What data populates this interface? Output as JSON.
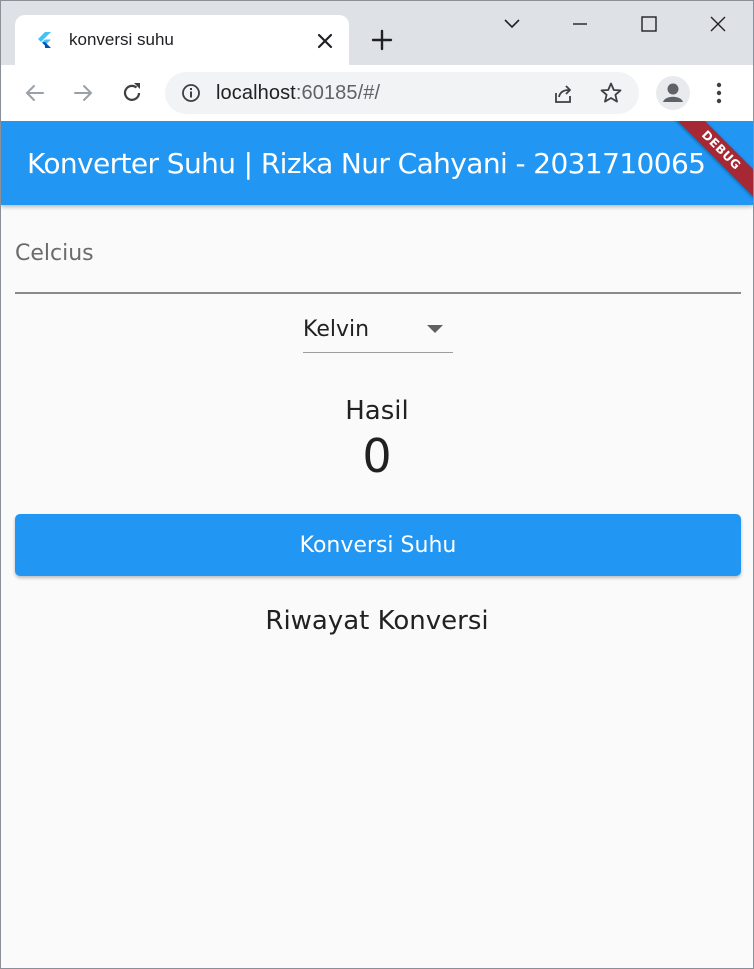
{
  "browser": {
    "tab": {
      "title": "konversi suhu",
      "favicon": "flutter-logo-icon"
    },
    "address": {
      "host": "localhost",
      "rest": ":60185/#/"
    },
    "icons": {
      "back": "arrow-left-icon",
      "forward": "arrow-right-icon",
      "reload": "reload-icon",
      "info": "info-icon",
      "share": "share-icon",
      "star": "star-icon",
      "profile": "avatar-icon",
      "menu": "three-dot-menu-icon"
    }
  },
  "app": {
    "appbar_title": "Konverter Suhu | Rizka Nur Cahyani - 2031710065",
    "debug_banner": "DEBUG",
    "input_label": "Celcius",
    "dropdown_value": "Kelvin",
    "result_label": "Hasil",
    "result_value": "0",
    "convert_button": "Konversi Suhu",
    "history_title": "Riwayat Konversi"
  },
  "colors": {
    "primary": "#2196f3",
    "debug_banner": "#a52834",
    "background": "#fafafa"
  }
}
